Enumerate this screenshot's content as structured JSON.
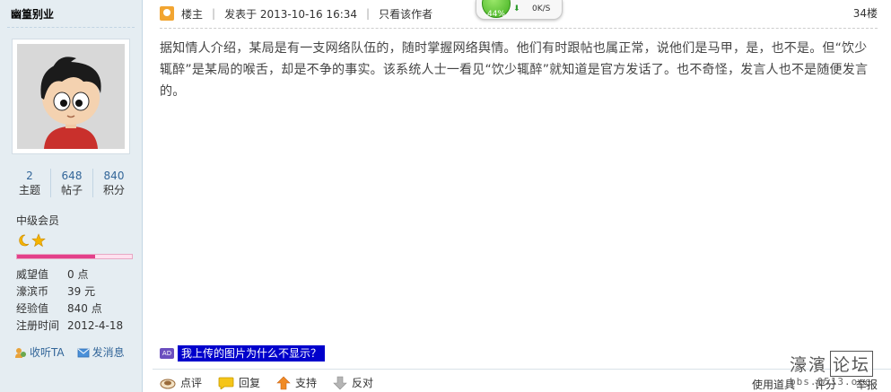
{
  "sidebar": {
    "username": "幽篁别业",
    "stats": [
      {
        "value": "2",
        "label": "主题"
      },
      {
        "value": "648",
        "label": "帖子"
      },
      {
        "value": "840",
        "label": "积分"
      }
    ],
    "rank": "中级会员",
    "rank_icons": [
      "moon-icon",
      "star-icon"
    ],
    "progress_fraction": 0.68,
    "info": [
      {
        "key": "威望值",
        "value": "0 点"
      },
      {
        "key": "濠滨币",
        "value": "39 元"
      },
      {
        "key": "经验值",
        "value": "840 点"
      },
      {
        "key": "注册时间",
        "value": "2012-4-18"
      }
    ],
    "listen_label": "收听TA",
    "message_label": "发消息"
  },
  "post": {
    "role": "楼主",
    "posted_at": "发表于 2013-10-16 16:34",
    "author_only": "只看该作者",
    "floor": "34楼",
    "body": "据知情人介绍，某局是有一支网络队伍的，随时掌握网络舆情。他们有时跟帖也属正常，说他们是马甲，是，也不是。但“饮少辄醉”是某局的喉舌，却是不争的事实。该系统人士一看见“饮少辄醉”就知道是官方发话了。也不奇怪，发言人也不是随便发言的。",
    "ad_badge": "AD",
    "ad_link": "我上传的图片为什么不显示？"
  },
  "footer": {
    "actions": [
      {
        "label": "点评",
        "icon": "comment-icon"
      },
      {
        "label": "回复",
        "icon": "reply-icon"
      },
      {
        "label": "支持",
        "icon": "up-arrow-icon"
      },
      {
        "label": "反对",
        "icon": "down-arrow-icon"
      }
    ],
    "tools": [
      "使用道具",
      "评分",
      "举报"
    ]
  },
  "net_widget": {
    "percent": "44%",
    "speed": "0K/S"
  },
  "watermark": {
    "main": "濠濱",
    "boxed": "论坛",
    "sub": "bbs.0513.org"
  },
  "colors": {
    "sidebar_bg": "#e5edf2",
    "link": "#336699",
    "ad_bg": "#0000cc",
    "progress": "#e3408a"
  }
}
